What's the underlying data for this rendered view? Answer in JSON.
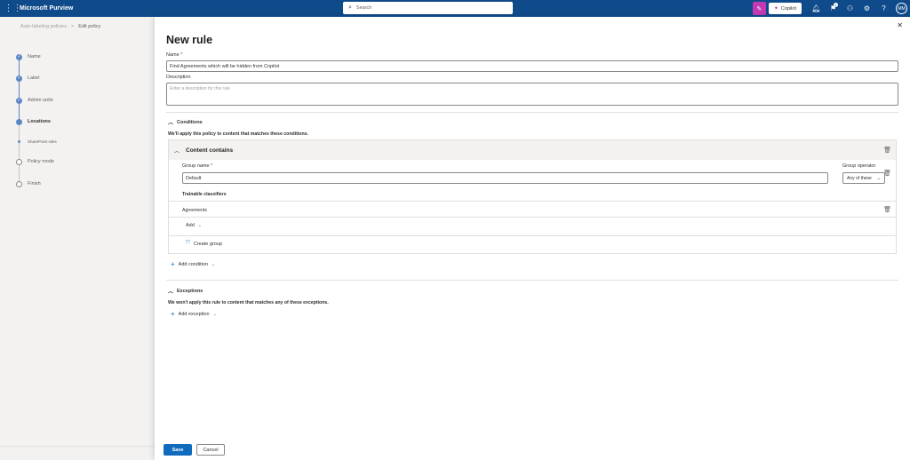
{
  "topbar": {
    "app_name": "Microsoft Purview",
    "search_placeholder": "Search",
    "copilot_label": "Copilot",
    "notification_count": "1",
    "avatar_initials": "MM"
  },
  "breadcrumb": {
    "parent": "Auto-labeling policies",
    "separator": ">",
    "current": "Edit policy"
  },
  "steps": [
    {
      "label": "Name"
    },
    {
      "label": "Label"
    },
    {
      "label": "Admin units"
    },
    {
      "label": "Locations"
    },
    {
      "label": "SharePoint sites"
    },
    {
      "label": "Policy mode"
    },
    {
      "label": "Finish"
    }
  ],
  "panel": {
    "title": "New rule",
    "name_label": "Name",
    "name_required": "*",
    "name_value": "Find Agreements which will be hidden from Copilot",
    "description_label": "Description",
    "description_placeholder": "Enter a description for this rule",
    "conditions": {
      "heading": "Conditions",
      "description": "We'll apply this policy to content that matches these conditions.",
      "content_contains": "Content contains",
      "group_name_label": "Group name",
      "group_name_required": "*",
      "group_name_value": "Default",
      "group_operator_label": "Group operator",
      "group_operator_value": "Any of these",
      "classifiers_heading": "Trainable classifiers",
      "classifier_item": "Agreements",
      "add_label": "Add",
      "create_group_label": "Create group",
      "add_condition_label": "Add condition"
    },
    "exceptions": {
      "heading": "Exceptions",
      "description": "We won't apply this rule to content that matches any of these exceptions.",
      "add_exception_label": "Add exception"
    }
  },
  "footer": {
    "save_label": "Save",
    "cancel_label": "Cancel"
  }
}
